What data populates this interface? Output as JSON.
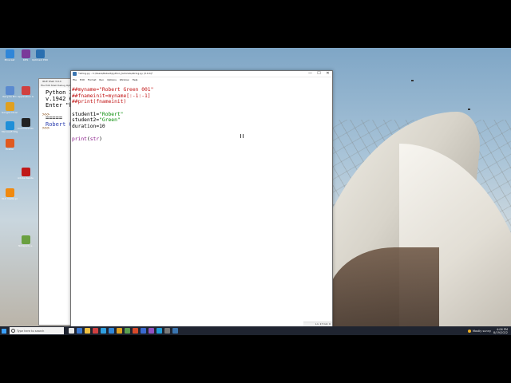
{
  "desktop_icons": [
    {
      "label": "Miracast",
      "color": "#2f86d8"
    },
    {
      "label": "KPIS",
      "color": "#7a3a9a"
    },
    {
      "label": "OptiCast PRO System",
      "color": "#2a6fb0"
    },
    {
      "label": "Recycle Bin",
      "color": "#5a8ad0"
    },
    {
      "label": "Application Generator",
      "color": "#d04040"
    },
    {
      "label": "Google Chrome",
      "color": "#e0a020"
    },
    {
      "label": "Microsoft Edge",
      "color": "#1f8fd8"
    },
    {
      "label": "Firefox",
      "color": "#e05a20"
    },
    {
      "label": "Adobe Reader",
      "color": "#c01818"
    },
    {
      "label": "Command Prompt",
      "color": "#222222"
    },
    {
      "label": "VLC media player",
      "color": "#f08a10"
    },
    {
      "label": "Notepad++",
      "color": "#6aa040"
    }
  ],
  "shell": {
    "title": "IDLE Shell 3.9.4",
    "menu": "File Edit Shell Debug Options",
    "lines": [
      "Python 3",
      "v.1942 6",
      "Enter \"h",
      "",
      "=====",
      "Robert G"
    ],
    "prompts": [
      ">>>",
      ">>>"
    ]
  },
  "editor": {
    "title": "*string.py - C:/Users/Robert/python_tutorials/string.py (3.9.4)*",
    "window_buttons": [
      "—",
      "☐",
      "✕"
    ],
    "menu": [
      "File",
      "Edit",
      "Format",
      "Run",
      "Options",
      "Window",
      "Help"
    ],
    "code": [
      {
        "text": "##myname=\"Robert Green 001\"",
        "color": "red"
      },
      {
        "text": "##fnameinit=myname[:-1:-1]",
        "color": "red"
      },
      {
        "text": "##print(fnameinit)",
        "color": "red"
      },
      {
        "text": "",
        "color": "black"
      },
      {
        "text": "student1=\"Robert\"",
        "color": "mixed"
      },
      {
        "text": "student2=\"Green\"",
        "color": "mixed"
      },
      {
        "text": "duration=10",
        "color": "black"
      },
      {
        "text": "",
        "color": "black"
      },
      {
        "text": "print(str)",
        "color": "mixed"
      }
    ],
    "status": "Ln: 17  Col: 0"
  },
  "taskbar": {
    "search_placeholder": "Type here to search",
    "apps": [
      "#e8e8e8",
      "#3a78d0",
      "#f0c040",
      "#d04040",
      "#30a0e0",
      "#2f86d8",
      "#e0a020",
      "#5aa050",
      "#d84a2a",
      "#3a6ad0",
      "#9050c0",
      "#1f9bd8",
      "#7a7a7a",
      "#3a75b0"
    ],
    "weather": "Mostly sunny",
    "time": "4:06 PM",
    "date": "8/19/2022"
  }
}
